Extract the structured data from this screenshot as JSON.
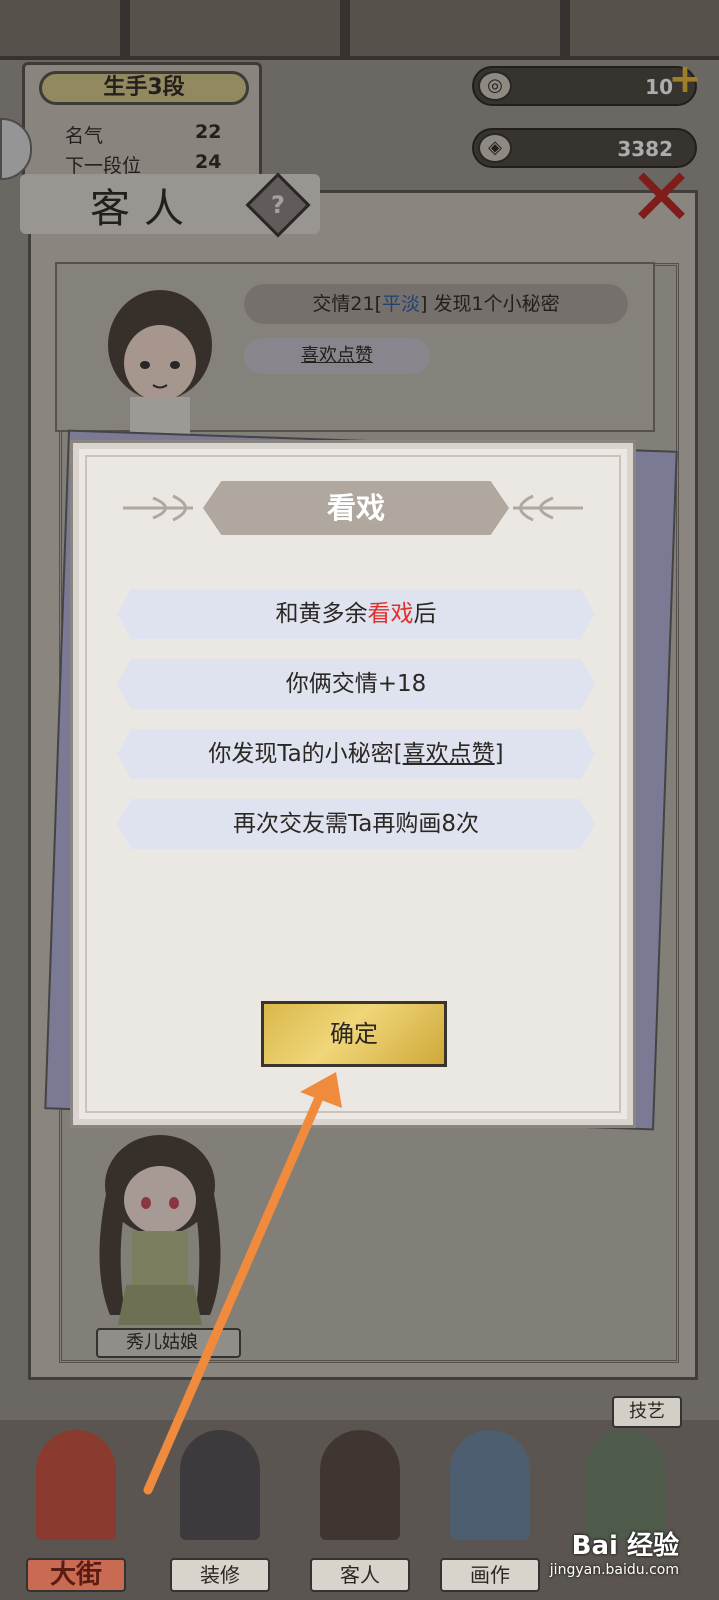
{
  "rank": {
    "title": "生手3段",
    "fame_label": "名气",
    "fame_value": "22",
    "next_label": "下一段位",
    "next_value": "24"
  },
  "currency": {
    "jade_value": "10",
    "coin_value": "3382"
  },
  "guest_panel": {
    "title": "客人",
    "help_icon": "?",
    "close_icon": "✕"
  },
  "guest_card": {
    "relation_prefix": "交情21[",
    "relation_state": "平淡",
    "relation_suffix": "] 发现1个小秘密",
    "secret_tag": "喜欢点赞"
  },
  "guest2": {
    "name": "秀儿姑娘"
  },
  "dialog": {
    "title": "看戏",
    "line1_prefix": "和黄多余",
    "line1_highlight": "看戏",
    "line1_suffix": "后",
    "line2": "你俩交情+18",
    "line3_prefix": "你发现Ta的小秘密[",
    "line3_link": "喜欢点赞",
    "line3_suffix": "]",
    "line4": "再次交友需Ta再购画8次",
    "confirm_label": "确定"
  },
  "nav": {
    "items": [
      "大街",
      "装修",
      "客人",
      "画作",
      "技艺"
    ],
    "skill_label": "技艺"
  },
  "watermark": {
    "brand": "Bai 经验",
    "site": "jingyan.baidu.com"
  },
  "colors": {
    "highlight_red": "#e0302a",
    "relation_blue": "#2a5ca8",
    "confirm_gold": "#f0d679",
    "close_red": "#b82420",
    "arrow_orange": "#f08a3c"
  }
}
